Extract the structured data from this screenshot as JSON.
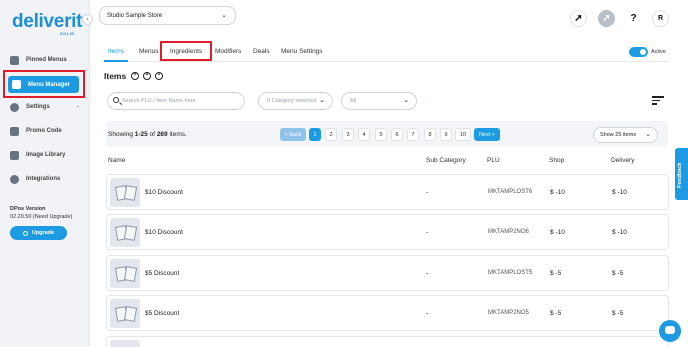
{
  "sidebar": {
    "logo": "deliverit",
    "logo_sub": "SOLID",
    "items": [
      {
        "label": "Pinned Menus",
        "icon": "pin-icon"
      },
      {
        "label": "Menu Manager",
        "icon": "menu-icon"
      },
      {
        "label": "Settings",
        "icon": "gear-icon"
      },
      {
        "label": "Promo Code",
        "icon": "tag-icon"
      },
      {
        "label": "Image Library",
        "icon": "image-icon"
      },
      {
        "label": "Integrations",
        "icon": "plug-icon"
      }
    ],
    "version_title": "DPos Version",
    "version_value": "02.20.50 (Need Upgrade)",
    "upgrade_label": "Upgrade"
  },
  "header": {
    "store": "Studio Sample Store",
    "avatar": "R"
  },
  "tabs": [
    "Items",
    "Menus",
    "Ingredients",
    "Modifiers",
    "Deals",
    "Menu Settings"
  ],
  "toggle_label": "Active",
  "title": "Items",
  "search": {
    "placeholder": "Search PLU / Item Name here"
  },
  "category_filter": "0 Category selected",
  "status_filter": "All",
  "pager": {
    "showing_prefix": "Showing ",
    "showing_range": "1-25",
    "showing_of": " of ",
    "showing_total": "269",
    "showing_suffix": " items.",
    "back": "< Back",
    "pages": [
      "1",
      "2",
      "3",
      "4",
      "5",
      "6",
      "7",
      "8",
      "9",
      "10"
    ],
    "next": "Next >",
    "page_size": "Show 25 items"
  },
  "table": {
    "headers": [
      "Name",
      "Sub Category",
      "PLU",
      "Shop",
      "Delivery"
    ],
    "rows": [
      {
        "name": "$10 Discount",
        "sub": "-",
        "plu": "MKTAMPLOST6",
        "shop": "$ -10",
        "delivery": "$ -10"
      },
      {
        "name": "$10 Discount",
        "sub": "-",
        "plu": "MKTAMP2NO6",
        "shop": "$ -10",
        "delivery": "$ -10"
      },
      {
        "name": "$5 Discount",
        "sub": "-",
        "plu": "MKTAMPLOST5",
        "shop": "$ -5",
        "delivery": "$ -5"
      },
      {
        "name": "$5 Discount",
        "sub": "-",
        "plu": "MKTAMP2NO5",
        "shop": "$ -5",
        "delivery": "$ -5"
      }
    ]
  },
  "feedback": "Feedback",
  "colors": {
    "accent": "#1c9be2",
    "highlight": "#e01d2d"
  }
}
